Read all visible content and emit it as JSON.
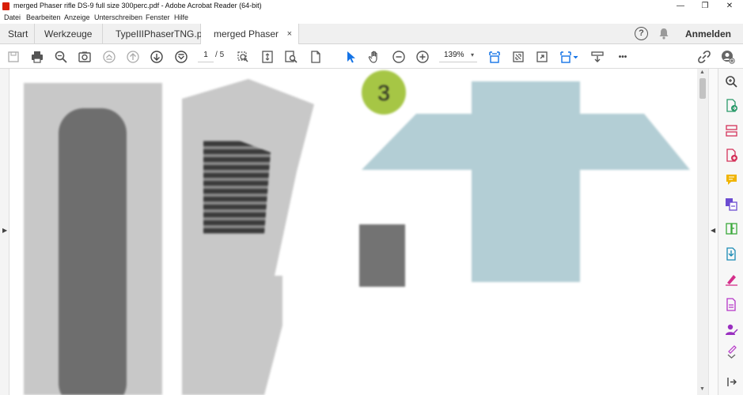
{
  "window": {
    "title": "merged Phaser rifle DS-9 full size 300perc.pdf - Adobe Acrobat Reader (64-bit)",
    "minimize": "—",
    "restore": "❐",
    "close": "✕"
  },
  "menu": [
    "Datei",
    "Bearbeiten",
    "Anzeige",
    "Unterschreiben",
    "Fenster",
    "Hilfe"
  ],
  "tabs": [
    {
      "label": "Start"
    },
    {
      "label": "Werkzeuge"
    },
    {
      "label": "TypeIIIPhaserTNG.p..."
    },
    {
      "label": "merged Phaser rifle...",
      "close": "×",
      "active": true
    }
  ],
  "header_right": {
    "help": "?",
    "sign_in": "Anmelden"
  },
  "toolbar": {
    "current_page": "1",
    "page_separator": "/",
    "total_pages": "5",
    "zoom": "139%",
    "zoom_caret": "▾",
    "more": "•••"
  },
  "document": {
    "badge_number": "3",
    "colors": {
      "light_gray": "#c8c8c8",
      "dark_gray": "#6e6e6e",
      "stripe": "#3a3a3a",
      "badge_green": "#a6c645",
      "light_blue": "#b3ced5"
    }
  },
  "right_panel": {
    "tools": [
      "zoom-search-icon",
      "export-pdf-icon",
      "organize-pages-icon",
      "create-pdf-icon",
      "comment-icon",
      "combine-files-icon",
      "edit-pdf-icon",
      "compress-pdf-icon",
      "fill-sign-icon",
      "protect-pdf-icon",
      "request-signature-icon",
      "more-tools-icon",
      "expand-panel-icon"
    ]
  }
}
